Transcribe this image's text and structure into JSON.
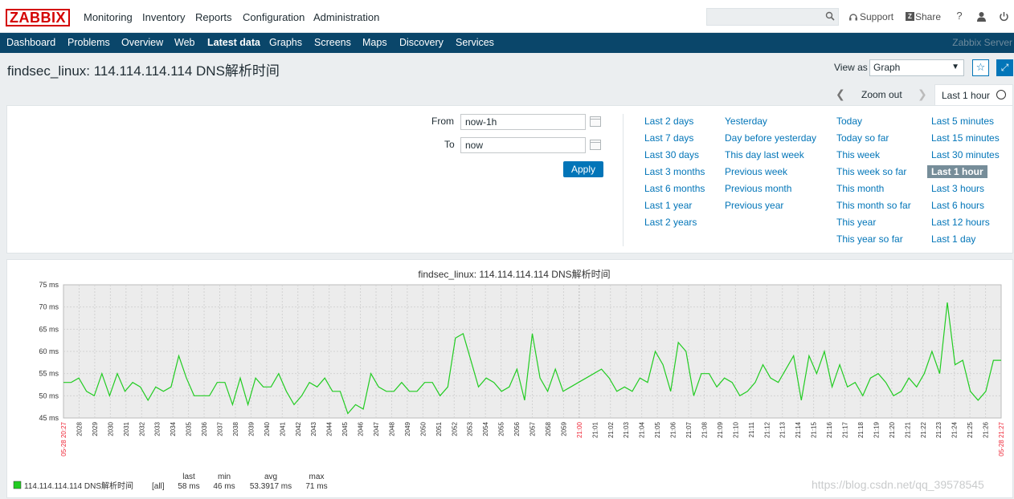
{
  "topbar": {
    "logo": "ZABBIX",
    "menu": [
      "Monitoring",
      "Inventory",
      "Reports",
      "Configuration",
      "Administration"
    ],
    "search_placeholder": "",
    "support": "Support",
    "share": "Share",
    "help": "?"
  },
  "subnav": {
    "items": [
      "Dashboard",
      "Problems",
      "Overview",
      "Web",
      "Latest data",
      "Graphs",
      "Screens",
      "Maps",
      "Discovery",
      "Services"
    ],
    "active": "Latest data",
    "server": "Zabbix Server"
  },
  "page": {
    "title": "findsec_linux: 114.114.114.114 DNS解析时间",
    "view_as_label": "View as",
    "view_as_value": "Graph"
  },
  "zoom": {
    "zoom_out": "Zoom out",
    "period": "Last 1 hour"
  },
  "filter": {
    "from_label": "From",
    "from_value": "now-1h",
    "to_label": "To",
    "to_value": "now",
    "apply": "Apply",
    "columns": [
      [
        "Last 2 days",
        "Last 7 days",
        "Last 30 days",
        "Last 3 months",
        "Last 6 months",
        "Last 1 year",
        "Last 2 years"
      ],
      [
        "Yesterday",
        "Day before yesterday",
        "This day last week",
        "Previous week",
        "Previous month",
        "Previous year"
      ],
      [
        "Today",
        "Today so far",
        "This week",
        "This week so far",
        "This month",
        "This month so far",
        "This year",
        "This year so far"
      ],
      [
        "Last 5 minutes",
        "Last 15 minutes",
        "Last 30 minutes",
        "Last 1 hour",
        "Last 3 hours",
        "Last 6 hours",
        "Last 12 hours",
        "Last 1 day"
      ]
    ],
    "selected": "Last 1 hour"
  },
  "chart_data": {
    "type": "line",
    "title": "findsec_linux: 114.114.114.114 DNS解析时间",
    "ylim": [
      45,
      75
    ],
    "yticks": [
      "75 ms",
      "70 ms",
      "65 ms",
      "60 ms",
      "55 ms",
      "50 ms",
      "45 ms"
    ],
    "xticks": [
      "05-28 20:27",
      "2028",
      "2029",
      "2030",
      "2031",
      "2032",
      "2033",
      "2034",
      "2035",
      "2036",
      "2037",
      "2038",
      "2039",
      "2040",
      "2041",
      "2042",
      "2043",
      "2044",
      "2045",
      "2046",
      "2047",
      "2048",
      "2049",
      "2050",
      "2051",
      "2052",
      "2053",
      "2054",
      "2055",
      "2056",
      "2057",
      "2058",
      "2059",
      "21:00",
      "21:01",
      "21:02",
      "21:03",
      "21:04",
      "21:05",
      "21:06",
      "21:07",
      "21:08",
      "21:09",
      "21:10",
      "21:11",
      "21:12",
      "21:13",
      "21:14",
      "21:15",
      "21:16",
      "21:17",
      "21:18",
      "21:19",
      "21:20",
      "21:21",
      "21:22",
      "21:23",
      "21:24",
      "21:25",
      "21:26",
      "05-28 21:27"
    ],
    "red_ticks": [
      "05-28 20:27",
      "21:00",
      "05-28 21:27"
    ],
    "series": [
      {
        "name": "114.114.114.114 DNS解析时间",
        "color": "#22cc22",
        "values": [
          53,
          53,
          54,
          51,
          50,
          55,
          50,
          55,
          51,
          53,
          52,
          49,
          52,
          51,
          52,
          59,
          54,
          50,
          50,
          50,
          53,
          53,
          48,
          54,
          48,
          54,
          52,
          52,
          55,
          51,
          48,
          50,
          53,
          52,
          54,
          51,
          51,
          46,
          48,
          47,
          55,
          52,
          51,
          51,
          53,
          51,
          51,
          53,
          53,
          50,
          52,
          63,
          64,
          58,
          52,
          54,
          53,
          51,
          52,
          56,
          49,
          64,
          54,
          51,
          56,
          51,
          52,
          53,
          54,
          55,
          56,
          54,
          51,
          52,
          51,
          54,
          53,
          60,
          57,
          51,
          62,
          60,
          50,
          55,
          55,
          52,
          54,
          53,
          50,
          51,
          53,
          57,
          54,
          53,
          56,
          59,
          49,
          59,
          55,
          60,
          52,
          57,
          52,
          53,
          50,
          54,
          55,
          53,
          50,
          51,
          54,
          52,
          55,
          60,
          55,
          71,
          57,
          58,
          51,
          49,
          51,
          58,
          58
        ]
      }
    ],
    "legend": {
      "label": "114.114.114.114 DNS解析时间",
      "func": "[all]",
      "headers": [
        "last",
        "min",
        "avg",
        "max"
      ],
      "values": [
        "58 ms",
        "46 ms",
        "53.3917 ms",
        "71 ms"
      ]
    }
  },
  "watermark": "https://blog.csdn.net/qq_39578545"
}
